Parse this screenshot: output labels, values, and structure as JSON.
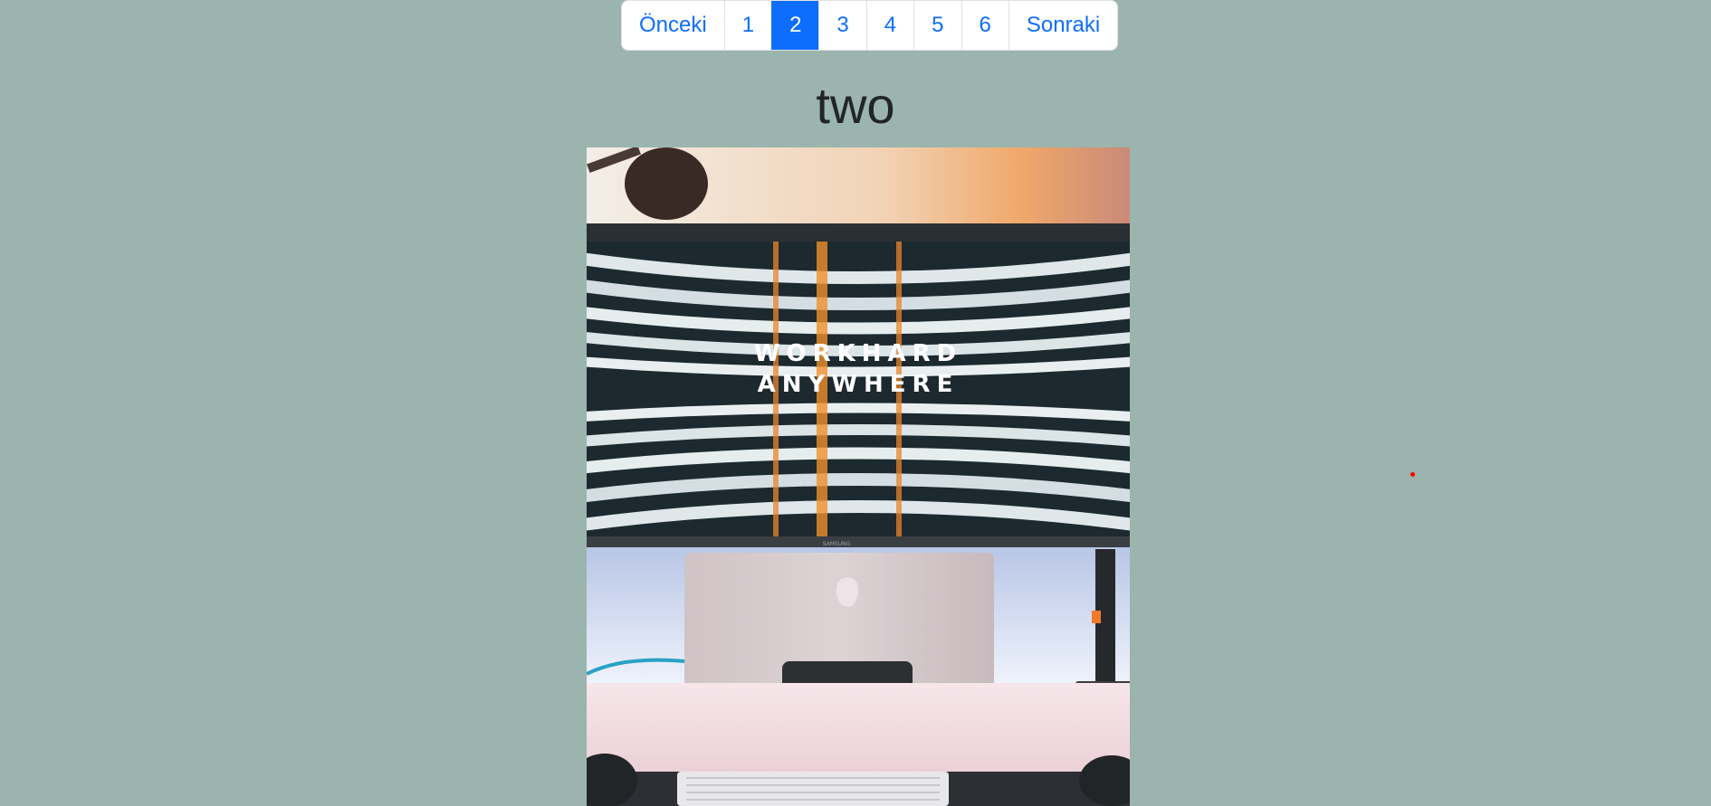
{
  "pagination": {
    "prev_label": "Önceki",
    "pages": [
      "1",
      "2",
      "3",
      "4",
      "5",
      "6"
    ],
    "active_page": "2",
    "next_label": "Sonraki"
  },
  "page_title": "two",
  "photo": {
    "screen_line_1": "WORKHARD",
    "screen_line_2": "ANYWHERE",
    "monitor_brand": "SAMSUNG"
  },
  "colors": {
    "background": "#9bb4ae",
    "accent": "#0d6efd",
    "pointer_dot": "#ff0000"
  }
}
